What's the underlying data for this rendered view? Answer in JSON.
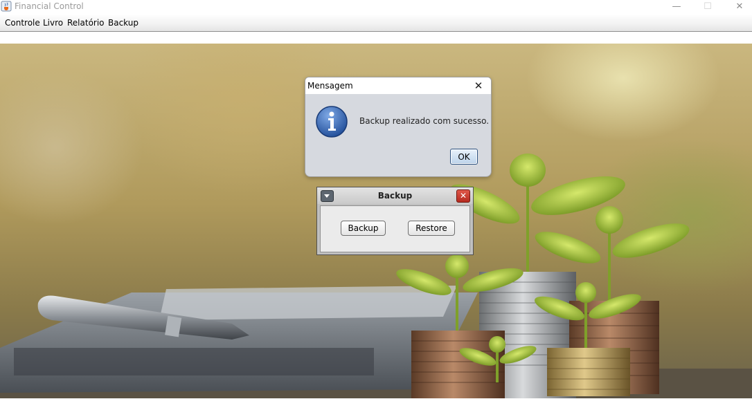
{
  "window": {
    "title": "Financial Control",
    "controls": [
      "minimize",
      "maximize",
      "close"
    ]
  },
  "menubar": {
    "items": [
      {
        "label": "Controle"
      },
      {
        "label": "Livro"
      },
      {
        "label": "Relatório"
      },
      {
        "label": "Backup"
      }
    ]
  },
  "message_dialog": {
    "title": "Mensagem",
    "icon": "info-icon",
    "message": "Backup realizado com sucesso.",
    "ok_label": "OK"
  },
  "backup_frame": {
    "title": "Backup",
    "backup_label": "Backup",
    "restore_label": "Restore"
  },
  "colors": {
    "dialog_bg": "#d6d9df",
    "frame_close": "#c0392b",
    "info_icon": "#2f5fa8"
  }
}
